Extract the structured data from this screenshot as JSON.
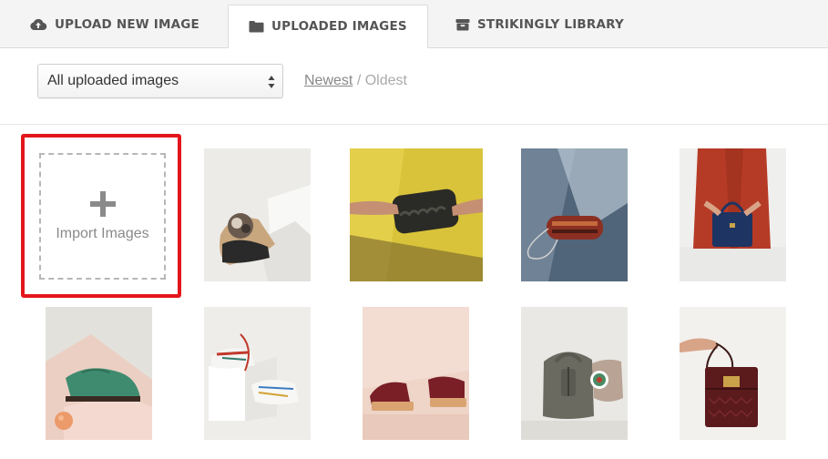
{
  "tabs": [
    {
      "label": "UPLOAD NEW IMAGE",
      "icon": "cloud-upload-icon"
    },
    {
      "label": "UPLOADED IMAGES",
      "icon": "folder-icon",
      "active": true
    },
    {
      "label": "STRIKINGLY LIBRARY",
      "icon": "archive-box-icon"
    }
  ],
  "filter": {
    "selected": "All uploaded images"
  },
  "sort": {
    "newest": "Newest",
    "separator": "/",
    "oldest": "Oldest"
  },
  "import": {
    "label": "Import Images",
    "highlight_color": "#e3161c"
  },
  "images": [
    {
      "subject": "flat mule with bow on white blocks"
    },
    {
      "subject": "hands holding black clutch on yellow"
    },
    {
      "subject": "red box clutch with chain on blue"
    },
    {
      "subject": "woman in red holding navy handbag"
    },
    {
      "subject": "teal oxford shoe with peach"
    },
    {
      "subject": "white sneakers on blocks"
    },
    {
      "subject": "burgundy platform sandals"
    },
    {
      "subject": "grey backpack held by person"
    },
    {
      "subject": "hand holding brown croc crossbody bag"
    }
  ]
}
